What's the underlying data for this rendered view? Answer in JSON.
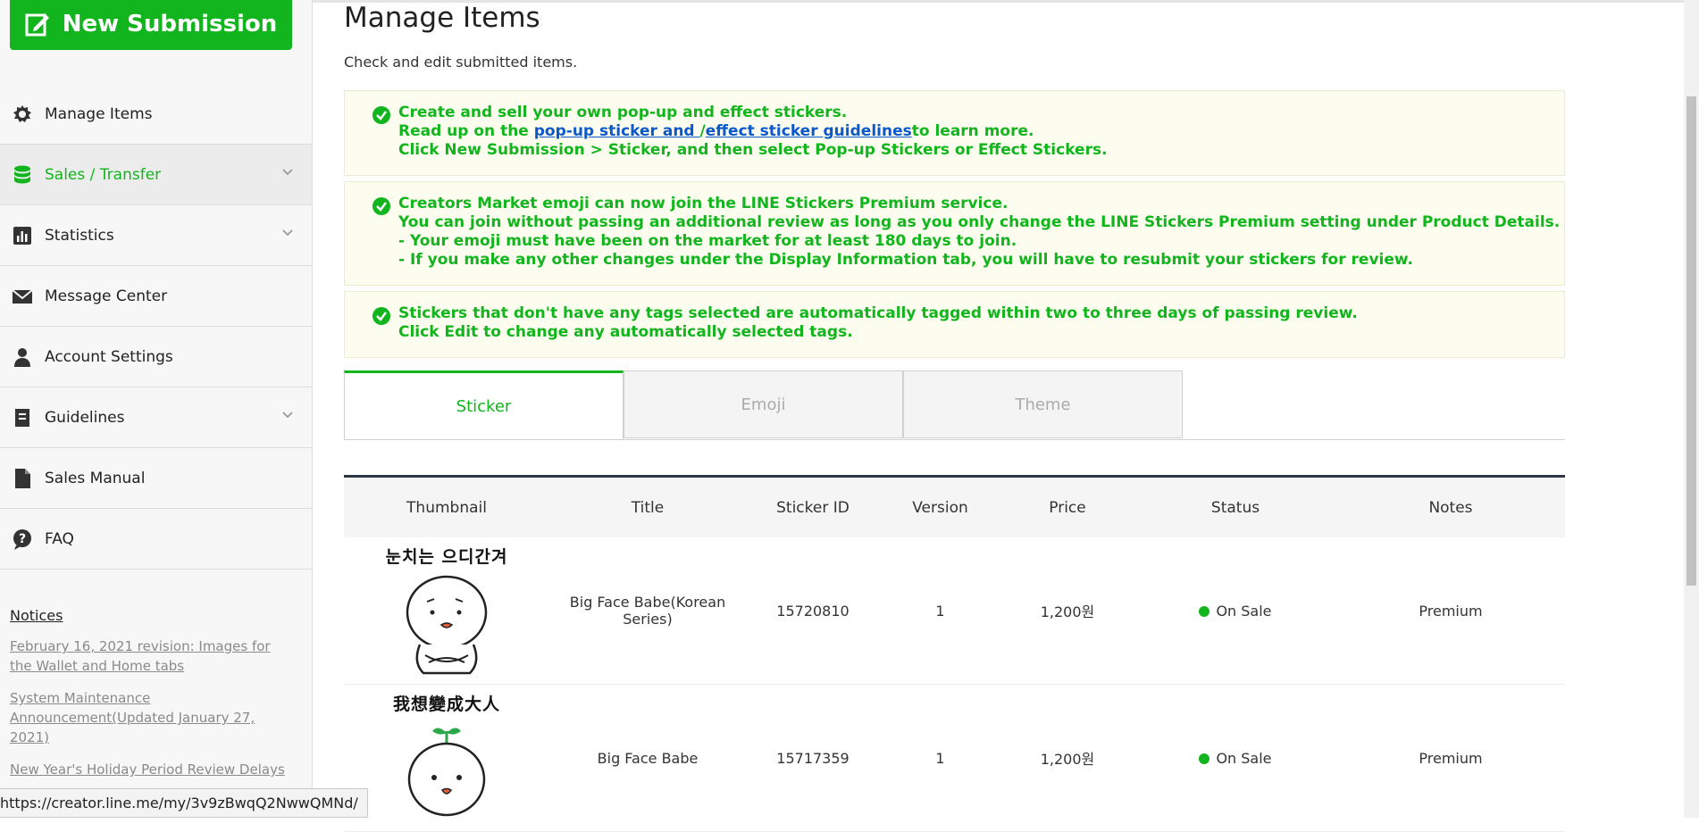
{
  "sidebar": {
    "new_submission_label": "New Submission",
    "items": [
      {
        "label": "Manage Items",
        "icon": "gear-icon"
      },
      {
        "label": "Sales / Transfer",
        "icon": "database-icon"
      },
      {
        "label": "Statistics",
        "icon": "bar-chart-icon"
      },
      {
        "label": "Message Center",
        "icon": "envelope-icon"
      },
      {
        "label": "Account Settings",
        "icon": "person-icon"
      },
      {
        "label": "Guidelines",
        "icon": "book-icon"
      },
      {
        "label": "Sales Manual",
        "icon": "document-icon"
      },
      {
        "label": "FAQ",
        "icon": "question-icon"
      }
    ],
    "notices_title": "Notices",
    "notices": [
      "February 16, 2021 revision: Images for the Wallet and Home tabs",
      "System Maintenance Announcement(Updated January 27, 2021)",
      "New Year's Holiday Period Review Delays"
    ]
  },
  "main": {
    "title": "Manage Items",
    "description": "Check and edit submitted items.",
    "notice1": {
      "line1": "Create and sell your own pop-up and effect stickers.",
      "line2_prefix": "Read up on the ",
      "link1": "pop-up sticker and ",
      "sep": "/",
      "link2": "effect sticker guidelines",
      "line2_suffix": "to learn more.",
      "line3": "Click New Submission > Sticker, and then select Pop-up Stickers or Effect Stickers."
    },
    "notice2": {
      "line1": "Creators Market emoji can now join the LINE Stickers Premium service.",
      "line2": "You can join without passing an additional review as long as you only change the LINE Stickers Premium setting under Product Details.",
      "line3": "- Your emoji must have been on the market for at least 180 days to join.",
      "line4": "- If you make any other changes under the Display Information tab, you will have to resubmit your stickers for review."
    },
    "notice3": {
      "line1": "Stickers that don't have any tags selected are automatically tagged within two to three days of passing review.",
      "line2": "Click Edit to change any automatically selected tags."
    },
    "tabs": [
      "Sticker",
      "Emoji",
      "Theme"
    ],
    "table": {
      "headers": [
        "Thumbnail",
        "Title",
        "Sticker ID",
        "Version",
        "Price",
        "Status",
        "Notes"
      ],
      "rows": [
        {
          "caption": "눈치는 으디간겨",
          "title": "Big Face Babe(Korean Series)",
          "id": "15720810",
          "version": "1",
          "price": "1,200원",
          "status": "On Sale",
          "notes": "Premium"
        },
        {
          "caption": "我想變成大人",
          "title": "Big Face Babe",
          "id": "15717359",
          "version": "1",
          "price": "1,200원",
          "status": "On Sale",
          "notes": "Premium"
        }
      ]
    }
  },
  "status_bar_url": "https://creator.line.me/my/3v9zBwqQ2NwwQMNd/",
  "colors": {
    "accent": "#12b51d",
    "link": "#0a58ca",
    "notice_bg": "#fdfdef"
  }
}
